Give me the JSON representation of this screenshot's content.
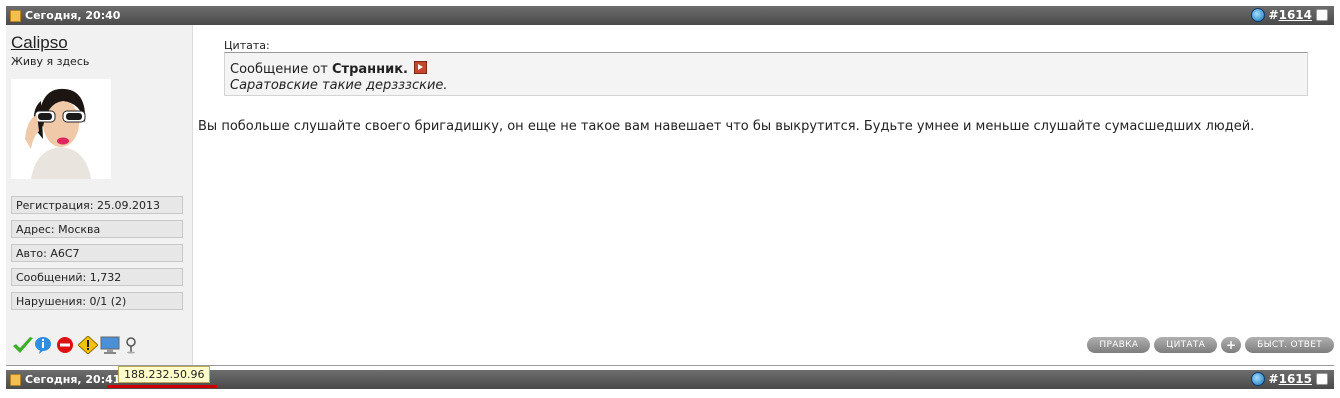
{
  "post1": {
    "date": "Сегодня, 20:40",
    "number": "1614",
    "hash": "#",
    "user": {
      "name": "Calipso",
      "title": "Живу я здесь",
      "fields": [
        "Регистрация: 25.09.2013",
        "Адрес: Москва",
        "Авто: А6С7",
        "Сообщений: 1,732",
        "Нарушения: 0/1 (2)"
      ],
      "status_icons": [
        "checkmark-icon",
        "info-icon",
        "no-entry-icon",
        "warning-icon",
        "computer-icon",
        "pin-icon"
      ]
    },
    "quote": {
      "label": "Цитата:",
      "prefix": "Сообщение от",
      "author": "Странник.",
      "text": "Саратовские такие дерзззские."
    },
    "message": "Вы побольше слушайте своего бригадишку, он еще не такое вам навешает что бы выкрутится. Будьте умнее и меньше слушайте сумасшедших людей.",
    "buttons": {
      "edit": "ПРАВКА",
      "quote": "ЦИТАТА",
      "plus": "+",
      "quick_reply": "БЫСТ. ОТВЕТ"
    }
  },
  "post2": {
    "date": "Сегодня, 20:41",
    "number": "1615",
    "hash": "#",
    "ip_tooltip": "188.232.50.96"
  },
  "colors": {
    "header_bg": "#5a5a5a",
    "sidebar_bg": "#f1f1f1",
    "ip_underline": "#cc0000",
    "tooltip_bg": "#ffffcc"
  }
}
